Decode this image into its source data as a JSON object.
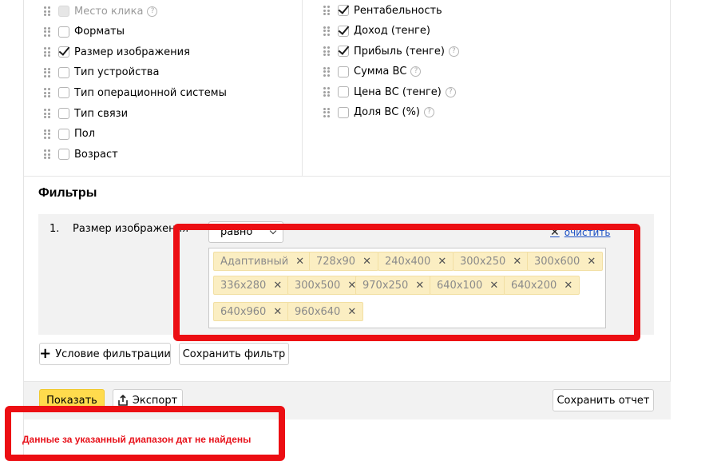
{
  "columns_left": [
    {
      "label": "Место клика",
      "checked": false,
      "disabled": true,
      "help": true
    },
    {
      "label": "Форматы",
      "checked": false,
      "disabled": false,
      "help": false
    },
    {
      "label": "Размер изображения",
      "checked": true,
      "disabled": false,
      "help": false
    },
    {
      "label": "Тип устройства",
      "checked": false,
      "disabled": false,
      "help": false
    },
    {
      "label": "Тип операционной системы",
      "checked": false,
      "disabled": false,
      "help": false
    },
    {
      "label": "Тип связи",
      "checked": false,
      "disabled": false,
      "help": false
    },
    {
      "label": "Пол",
      "checked": false,
      "disabled": false,
      "help": false
    },
    {
      "label": "Возраст",
      "checked": false,
      "disabled": false,
      "help": false
    }
  ],
  "columns_right": [
    {
      "label": "Рентабельность",
      "checked": true,
      "help": false
    },
    {
      "label": "Доход (тенге)",
      "checked": true,
      "help": false
    },
    {
      "label": "Прибыль (тенге)",
      "checked": true,
      "help": true
    },
    {
      "label": "Сумма ВС",
      "checked": false,
      "help": true
    },
    {
      "label": "Цена ВС (тенге)",
      "checked": false,
      "help": true
    },
    {
      "label": "Доля ВС (%)",
      "checked": false,
      "help": true
    }
  ],
  "help_glyph": "?",
  "filters": {
    "title": "Фильтры",
    "row_number": "1.",
    "field": "Размер изображения",
    "operator": "равно",
    "clear_label": "очистить",
    "clear_icon": "close-icon",
    "tags": [
      "Адаптивный",
      "728x90",
      "240x400",
      "300x250",
      "300x600",
      "336x280",
      "300x500",
      "970x250",
      "640x100",
      "640x200",
      "640x960",
      "960x640"
    ],
    "tag_remove_glyph": "✕"
  },
  "buttons": {
    "add_condition": "Условие фильтрации",
    "save_filter": "Сохранить фильтр",
    "show": "Показать",
    "export": "Экспорт",
    "save_report": "Сохранить отчет"
  },
  "error_message": "Данные за указанный диапазон дат не найдены",
  "colors": {
    "primary_button": "#ffdb4d",
    "tag_background": "#fbeec2",
    "highlight_frame": "#ec0e13",
    "error_text": "#e8121b",
    "link": "#1a4fc4"
  }
}
